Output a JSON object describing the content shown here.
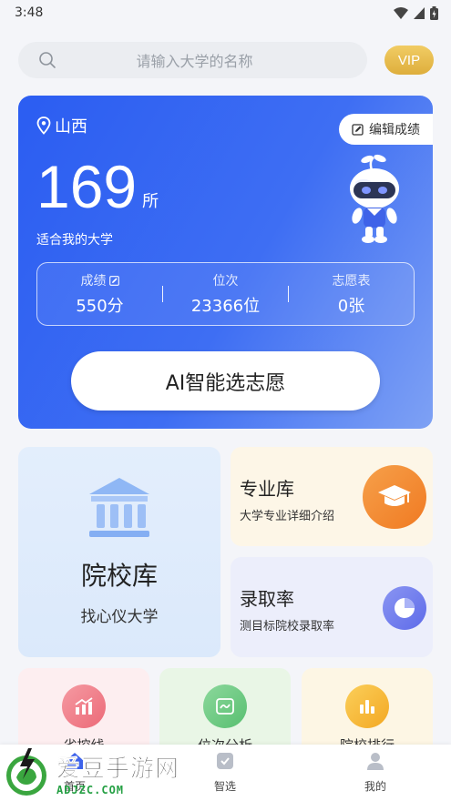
{
  "status_bar": {
    "time": "3:48"
  },
  "search": {
    "placeholder": "请输入大学的名称"
  },
  "vip": {
    "label": "VIP"
  },
  "hero": {
    "location": "山西",
    "edit_score_label": "编辑成绩",
    "count": "169",
    "count_unit": "所",
    "subtitle": "适合我的大学",
    "stats": [
      {
        "label": "成绩",
        "value": "550分"
      },
      {
        "label": "位次",
        "value": "23366位"
      },
      {
        "label": "志愿表",
        "value": "0张"
      }
    ],
    "ai_button_label": "AI智能选志愿"
  },
  "features": {
    "colleges": {
      "title": "院校库",
      "subtitle": "找心仪大学"
    },
    "majors": {
      "title": "专业库",
      "subtitle": "大学专业详细介绍"
    },
    "admission": {
      "title": "录取率",
      "subtitle": "测目标院校录取率"
    }
  },
  "tools": [
    {
      "label": "省控线",
      "icon": "chart-up-icon"
    },
    {
      "label": "位次分析",
      "icon": "trend-icon"
    },
    {
      "label": "院校排行",
      "icon": "bar-chart-icon"
    }
  ],
  "bottom_nav": [
    {
      "label": "首页",
      "icon": "home-icon"
    },
    {
      "label": "智选",
      "icon": "smart-select-icon"
    },
    {
      "label": "我的",
      "icon": "user-icon"
    }
  ],
  "watermark": {
    "title": "爱豆手游网",
    "url": "ADJZC.COM"
  },
  "colors": {
    "hero_blue": "#2b5df2",
    "vip_gold": "#e4b445",
    "majors_orange": "#f07a22",
    "admission_indigo": "#5e6be9"
  }
}
